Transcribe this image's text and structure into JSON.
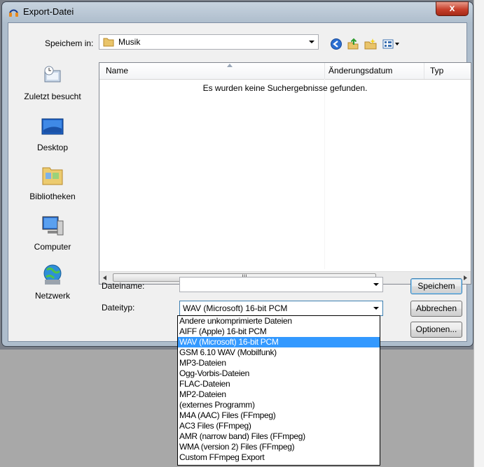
{
  "window": {
    "title": "Export-Datei",
    "close_glyph": "x"
  },
  "toolbar": {
    "save_in_label": "Speichem in:",
    "location": "Musik",
    "icons": [
      "back-icon",
      "up-folder-icon",
      "new-folder-icon",
      "view-menu-icon"
    ]
  },
  "places": [
    {
      "label": "Zuletzt besucht",
      "icon": "recent-places-icon"
    },
    {
      "label": "Desktop",
      "icon": "desktop-icon"
    },
    {
      "label": "Bibliotheken",
      "icon": "libraries-icon"
    },
    {
      "label": "Computer",
      "icon": "computer-icon"
    },
    {
      "label": "Netzwerk",
      "icon": "network-icon"
    }
  ],
  "filelist": {
    "columns": [
      "Name",
      "Änderungsdatum",
      "Typ"
    ],
    "empty_message": "Es wurden keine Suchergebnisse gefunden.",
    "scroll_thumb_text": "III"
  },
  "form": {
    "filename_label": "Dateiname:",
    "filename_value": "",
    "filetype_label": "Dateityp:",
    "filetype_value": "WAV (Microsoft) 16-bit PCM"
  },
  "buttons": {
    "save": "Speichem",
    "cancel": "Abbrechen",
    "options": "Optionen..."
  },
  "filetype_options": [
    "Andere unkomprimierte Dateien",
    "AIFF (Apple) 16-bit PCM",
    "WAV (Microsoft) 16-bit PCM",
    "GSM 6.10 WAV (Mobilfunk)",
    "MP3-Dateien",
    "Ogg-Vorbis-Dateien",
    "FLAC-Dateien",
    "MP2-Dateien",
    "(externes Programm)",
    "M4A (AAC) Files (FFmpeg)",
    "AC3 Files (FFmpeg)",
    "AMR (narrow band) Files (FFmpeg)",
    "WMA (version 2) Files (FFmpeg)",
    "Custom FFmpeg Export"
  ],
  "selected_option": "WAV (Microsoft) 16-bit PCM",
  "colors": {
    "selection": "#3399ff",
    "title_bar": "#aebdcc",
    "close_button": "#c7402c"
  }
}
